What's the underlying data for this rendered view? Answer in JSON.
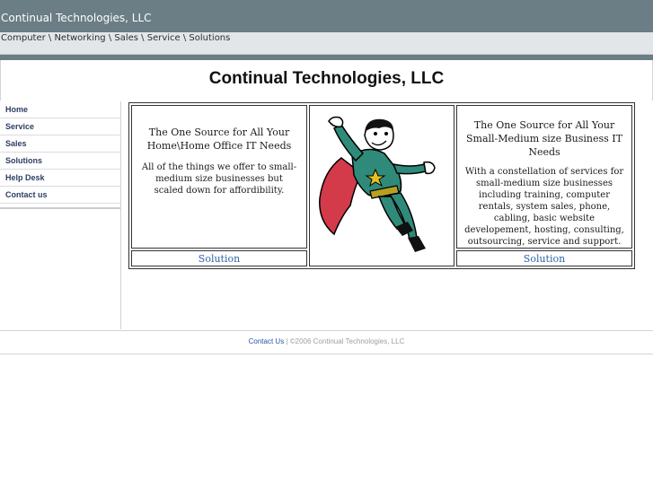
{
  "site": {
    "name": "Continual Technologies, LLC",
    "tagline": "Computer \\ Networking \\ Sales \\ Service \\ Solutions",
    "title": "Continual Technologies, LLC"
  },
  "nav": {
    "items": [
      "Home",
      "Service",
      "Sales",
      "Solutions",
      "Help Desk",
      "Contact us"
    ]
  },
  "panels": {
    "left": {
      "heading": "The One Source for All Your Home\\Home Office IT Needs",
      "body": "All of the things we offer to small-medium size businesses but scaled down for affordibility.",
      "link": "Solution"
    },
    "right": {
      "heading": "The One Source for All Your Small-Medium size Business IT Needs",
      "body": "With a constellation of services for small-medium size businesses including training, computer rentals, system sales, phone, cabling, basic website developement, hosting, consulting, outsourcing, service and support.",
      "link": "Solution"
    },
    "mascot": "superhero-mascot"
  },
  "footer": {
    "contact": "Contact Us",
    "separator": " | ",
    "copyright": "©2006 Continual Technologies, LLC"
  },
  "colors": {
    "topbar": "#6b7d85",
    "link": "#2f62a8",
    "nav_text": "#2c3e63"
  }
}
